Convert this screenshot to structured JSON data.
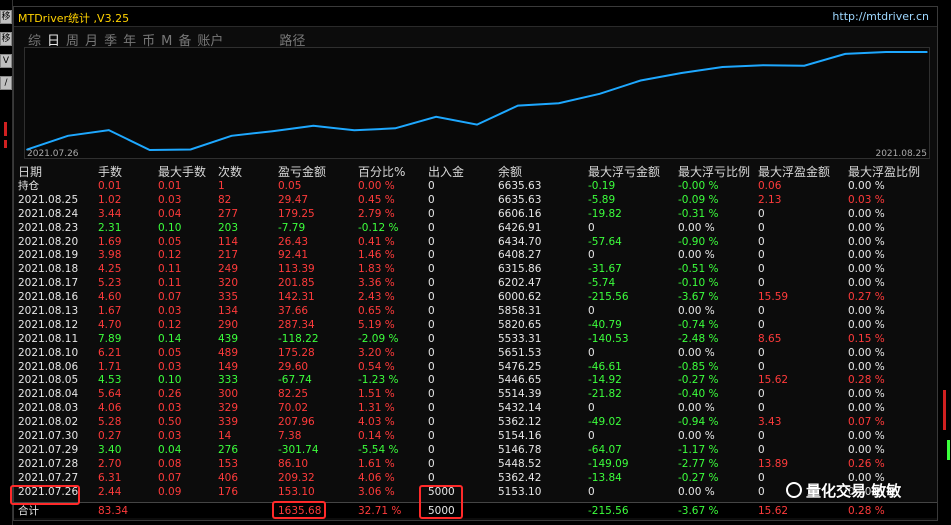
{
  "window": {
    "title": "MTDriver统计 ,V3.25",
    "url": "http://mtdriver.cn"
  },
  "left_strip": {
    "buttons": [
      "移",
      "移",
      "V",
      "/"
    ]
  },
  "tabs": [
    {
      "label": "综",
      "active": false
    },
    {
      "label": "日",
      "active": true
    },
    {
      "label": "周",
      "active": false
    },
    {
      "label": "月",
      "active": false
    },
    {
      "label": "季",
      "active": false
    },
    {
      "label": "年",
      "active": false
    },
    {
      "label": "币",
      "active": false
    },
    {
      "label": "M",
      "active": false
    },
    {
      "label": "备",
      "active": false
    },
    {
      "label": "账户",
      "active": false
    },
    {
      "label": "路径",
      "active": false
    }
  ],
  "chart_data": {
    "type": "line",
    "x_start_label": "2021.07.26",
    "x_end_label": "2021.08.25",
    "color": "#1ea8ff",
    "x": [
      "2021.07.26",
      "2021.07.27",
      "2021.07.28",
      "2021.07.29",
      "2021.07.30",
      "2021.08.02",
      "2021.08.03",
      "2021.08.04",
      "2021.08.05",
      "2021.08.06",
      "2021.08.09",
      "2021.08.10",
      "2021.08.11",
      "2021.08.12",
      "2021.08.13",
      "2021.08.16",
      "2021.08.17",
      "2021.08.18",
      "2021.08.19",
      "2021.08.20",
      "2021.08.23",
      "2021.08.24",
      "2021.08.25"
    ],
    "values": [
      5153.1,
      5362.42,
      5448.52,
      5146.78,
      5154.16,
      5362.12,
      5432.14,
      5514.39,
      5446.65,
      5476.25,
      5651.53,
      5533.31,
      5820.65,
      5858.31,
      6000.62,
      6202.47,
      6315.86,
      6408.27,
      6434.7,
      6426.91,
      6606.16,
      6635.63,
      6635.63
    ]
  },
  "table": {
    "headers": [
      "日期",
      "手数",
      "最大手数",
      "次数",
      "盈亏金额",
      "百分比%",
      "出入金",
      "余额",
      "最大浮亏金额",
      "最大浮亏比例",
      "最大浮盈金额",
      "最大浮盈比例"
    ],
    "rows": [
      {
        "date": "持仓",
        "lots": "0.01",
        "maxlots": "0.01",
        "count": "1",
        "pnl": "0.05",
        "pct": "0.00 %",
        "io": "0",
        "bal": "6635.63",
        "mfl": "-0.19",
        "mflp": "-0.00 %",
        "mfp": "0.06",
        "mfpp": "0.00 %",
        "pos": true
      },
      {
        "date": "2021.08.25",
        "lots": "1.02",
        "maxlots": "0.03",
        "count": "82",
        "pnl": "29.47",
        "pct": "0.45 %",
        "io": "0",
        "bal": "6635.63",
        "mfl": "-5.89",
        "mflp": "-0.09 %",
        "mfp": "2.13",
        "mfpp": "0.03 %",
        "pos": true
      },
      {
        "date": "2021.08.24",
        "lots": "3.44",
        "maxlots": "0.04",
        "count": "277",
        "pnl": "179.25",
        "pct": "2.79 %",
        "io": "0",
        "bal": "6606.16",
        "mfl": "-19.82",
        "mflp": "-0.31 %",
        "mfp": "0",
        "mfpp": "0.00 %",
        "pos": true
      },
      {
        "date": "2021.08.23",
        "lots": "2.31",
        "maxlots": "0.10",
        "count": "203",
        "pnl": "-7.79",
        "pct": "-0.12 %",
        "io": "0",
        "bal": "6426.91",
        "mfl": "0",
        "mflp": "0.00 %",
        "mfp": "0",
        "mfpp": "0.00 %",
        "pos": false
      },
      {
        "date": "2021.08.20",
        "lots": "1.69",
        "maxlots": "0.05",
        "count": "114",
        "pnl": "26.43",
        "pct": "0.41 %",
        "io": "0",
        "bal": "6434.70",
        "mfl": "-57.64",
        "mflp": "-0.90 %",
        "mfp": "0",
        "mfpp": "0.00 %",
        "pos": true
      },
      {
        "date": "2021.08.19",
        "lots": "3.98",
        "maxlots": "0.12",
        "count": "217",
        "pnl": "92.41",
        "pct": "1.46 %",
        "io": "0",
        "bal": "6408.27",
        "mfl": "0",
        "mflp": "0.00 %",
        "mfp": "0",
        "mfpp": "0.00 %",
        "pos": true
      },
      {
        "date": "2021.08.18",
        "lots": "4.25",
        "maxlots": "0.11",
        "count": "249",
        "pnl": "113.39",
        "pct": "1.83 %",
        "io": "0",
        "bal": "6315.86",
        "mfl": "-31.67",
        "mflp": "-0.51 %",
        "mfp": "0",
        "mfpp": "0.00 %",
        "pos": true
      },
      {
        "date": "2021.08.17",
        "lots": "5.23",
        "maxlots": "0.11",
        "count": "320",
        "pnl": "201.85",
        "pct": "3.36 %",
        "io": "0",
        "bal": "6202.47",
        "mfl": "-5.74",
        "mflp": "-0.10 %",
        "mfp": "0",
        "mfpp": "0.00 %",
        "pos": true
      },
      {
        "date": "2021.08.16",
        "lots": "4.60",
        "maxlots": "0.07",
        "count": "335",
        "pnl": "142.31",
        "pct": "2.43 %",
        "io": "0",
        "bal": "6000.62",
        "mfl": "-215.56",
        "mflp": "-3.67 %",
        "mfp": "15.59",
        "mfpp": "0.27 %",
        "pos": true
      },
      {
        "date": "2021.08.13",
        "lots": "1.67",
        "maxlots": "0.03",
        "count": "134",
        "pnl": "37.66",
        "pct": "0.65 %",
        "io": "0",
        "bal": "5858.31",
        "mfl": "0",
        "mflp": "0.00 %",
        "mfp": "0",
        "mfpp": "0.00 %",
        "pos": true
      },
      {
        "date": "2021.08.12",
        "lots": "4.70",
        "maxlots": "0.12",
        "count": "290",
        "pnl": "287.34",
        "pct": "5.19 %",
        "io": "0",
        "bal": "5820.65",
        "mfl": "-40.79",
        "mflp": "-0.74 %",
        "mfp": "0",
        "mfpp": "0.00 %",
        "pos": true
      },
      {
        "date": "2021.08.11",
        "lots": "7.89",
        "maxlots": "0.14",
        "count": "439",
        "pnl": "-118.22",
        "pct": "-2.09 %",
        "io": "0",
        "bal": "5533.31",
        "mfl": "-140.53",
        "mflp": "-2.48 %",
        "mfp": "8.65",
        "mfpp": "0.15 %",
        "pos": false
      },
      {
        "date": "2021.08.10",
        "lots": "6.21",
        "maxlots": "0.05",
        "count": "489",
        "pnl": "175.28",
        "pct": "3.20 %",
        "io": "0",
        "bal": "5651.53",
        "mfl": "0",
        "mflp": "0.00 %",
        "mfp": "0",
        "mfpp": "0.00 %",
        "pos": true
      },
      {
        "date": "2021.08.06",
        "lots": "1.71",
        "maxlots": "0.03",
        "count": "149",
        "pnl": "29.60",
        "pct": "0.54 %",
        "io": "0",
        "bal": "5476.25",
        "mfl": "-46.61",
        "mflp": "-0.85 %",
        "mfp": "0",
        "mfpp": "0.00 %",
        "pos": true
      },
      {
        "date": "2021.08.05",
        "lots": "4.53",
        "maxlots": "0.10",
        "count": "333",
        "pnl": "-67.74",
        "pct": "-1.23 %",
        "io": "0",
        "bal": "5446.65",
        "mfl": "-14.92",
        "mflp": "-0.27 %",
        "mfp": "15.62",
        "mfpp": "0.28 %",
        "pos": false
      },
      {
        "date": "2021.08.04",
        "lots": "5.64",
        "maxlots": "0.26",
        "count": "300",
        "pnl": "82.25",
        "pct": "1.51 %",
        "io": "0",
        "bal": "5514.39",
        "mfl": "-21.82",
        "mflp": "-0.40 %",
        "mfp": "0",
        "mfpp": "0.00 %",
        "pos": true
      },
      {
        "date": "2021.08.03",
        "lots": "4.06",
        "maxlots": "0.03",
        "count": "329",
        "pnl": "70.02",
        "pct": "1.31 %",
        "io": "0",
        "bal": "5432.14",
        "mfl": "0",
        "mflp": "0.00 %",
        "mfp": "0",
        "mfpp": "0.00 %",
        "pos": true
      },
      {
        "date": "2021.08.02",
        "lots": "5.28",
        "maxlots": "0.50",
        "count": "339",
        "pnl": "207.96",
        "pct": "4.03 %",
        "io": "0",
        "bal": "5362.12",
        "mfl": "-49.02",
        "mflp": "-0.94 %",
        "mfp": "3.43",
        "mfpp": "0.07 %",
        "pos": true
      },
      {
        "date": "2021.07.30",
        "lots": "0.27",
        "maxlots": "0.03",
        "count": "14",
        "pnl": "7.38",
        "pct": "0.14 %",
        "io": "0",
        "bal": "5154.16",
        "mfl": "0",
        "mflp": "0.00 %",
        "mfp": "0",
        "mfpp": "0.00 %",
        "pos": true
      },
      {
        "date": "2021.07.29",
        "lots": "3.40",
        "maxlots": "0.04",
        "count": "276",
        "pnl": "-301.74",
        "pct": "-5.54 %",
        "io": "0",
        "bal": "5146.78",
        "mfl": "-64.07",
        "mflp": "-1.17 %",
        "mfp": "0",
        "mfpp": "0.00 %",
        "pos": false
      },
      {
        "date": "2021.07.28",
        "lots": "2.70",
        "maxlots": "0.08",
        "count": "153",
        "pnl": "86.10",
        "pct": "1.61 %",
        "io": "0",
        "bal": "5448.52",
        "mfl": "-149.09",
        "mflp": "-2.77 %",
        "mfp": "13.89",
        "mfpp": "0.26 %",
        "pos": true
      },
      {
        "date": "2021.07.27",
        "lots": "6.31",
        "maxlots": "0.07",
        "count": "406",
        "pnl": "209.32",
        "pct": "4.06 %",
        "io": "0",
        "bal": "5362.42",
        "mfl": "-13.84",
        "mflp": "-0.27 %",
        "mfp": "0",
        "mfpp": "0.00 %",
        "pos": true
      },
      {
        "date": "2021.07.26",
        "lots": "2.44",
        "maxlots": "0.09",
        "count": "176",
        "pnl": "153.10",
        "pct": "3.06 %",
        "io": "5000",
        "bal": "5153.10",
        "mfl": "0",
        "mflp": "0.00 %",
        "mfp": "0",
        "mfpp": "0.00 %",
        "pos": true
      }
    ],
    "total": {
      "date": "合计",
      "lots": "83.34",
      "maxlots": "",
      "count": "",
      "pnl": "1635.68",
      "pct": "32.71 %",
      "io": "5000",
      "bal": "",
      "mfl": "-215.56",
      "mflp": "-3.67 %",
      "mfp": "15.62",
      "mfpp": "0.28 %"
    }
  },
  "watermark": "量化交易 敏敏",
  "colors": {
    "positive": "#ff3b3b",
    "negative": "#3cff3c",
    "line": "#1ea8ff",
    "title": "#ffd200",
    "highlight": "#ff2a2a"
  }
}
